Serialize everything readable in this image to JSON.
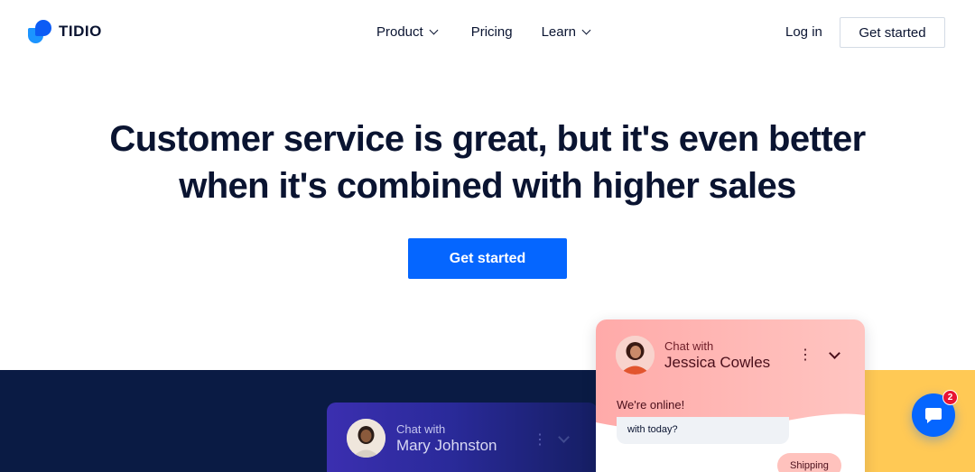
{
  "brand": {
    "name": "TIDIO"
  },
  "nav": {
    "items": [
      {
        "label": "Product"
      },
      {
        "label": "Pricing"
      },
      {
        "label": "Learn"
      }
    ]
  },
  "header": {
    "login_label": "Log in",
    "cta_label": "Get started"
  },
  "hero": {
    "line1_regular": "Customer service is great, but it's ",
    "line1_bold": "even better",
    "line2": "when it's combined with higher sales",
    "cta_label": "Get started"
  },
  "widgets": {
    "purple": {
      "chat_with": "Chat with",
      "name": "Mary Johnston"
    },
    "pink": {
      "chat_with": "Chat with",
      "name": "Jessica Cowles",
      "status": "We're online!",
      "message_partial": "with today?",
      "quick_reply": "Shipping"
    }
  },
  "launcher": {
    "badge_count": "2"
  },
  "colors": {
    "accent": "#0566ff",
    "navy": "#0a1b44",
    "yellow": "#ffc955",
    "pink": "#ffaaa9",
    "text": "#0a1431"
  }
}
